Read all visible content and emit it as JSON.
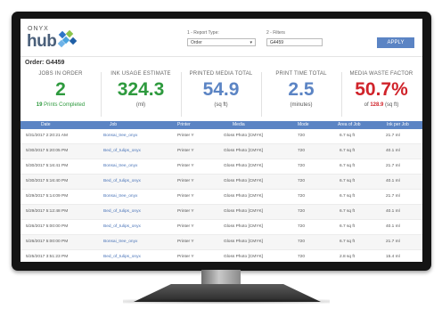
{
  "header": {
    "logo_top": "ONYX",
    "logo_main": "hub",
    "report_type_label": "1 - Report Type:",
    "report_type_value": "Order",
    "filters_label": "2 - Filters",
    "filters_value": "G4459",
    "apply_label": "APPLY"
  },
  "order": {
    "label": "Order:",
    "id": "G4459"
  },
  "kpis": [
    {
      "title": "JOBS IN ORDER",
      "value": "2",
      "sub_strong": "19",
      "sub_text": "Prints Completed",
      "color": "#2e9a3e"
    },
    {
      "title": "INK USAGE ESTIMATE",
      "value": "324.3",
      "sub_text": "(ml)",
      "color": "#2e9a3e"
    },
    {
      "title": "PRINTED MEDIA TOTAL",
      "value": "54.9",
      "sub_text": "(sq ft)",
      "color": "#5b84c4"
    },
    {
      "title": "PRINT TIME TOTAL",
      "value": "2.5",
      "sub_text": "(minutes)",
      "color": "#5b84c4"
    },
    {
      "title": "MEDIA WASTE FACTOR",
      "value": "50.7%",
      "sub_pre": "of",
      "sub_strong": "128.9",
      "sub_text": "(sq ft)",
      "color": "#d0232a"
    }
  ],
  "table": {
    "columns": [
      "Date",
      "Job",
      "Printer",
      "Media",
      "Mode",
      "Area of Job",
      "Ink per Job"
    ],
    "rows": [
      [
        "5/31/2017 2:20:21 AM",
        "Bonsai_tree_onyx",
        "Printer Y",
        "Gloss Photo [CMYK]",
        "720",
        "6.7 sq ft",
        "21.7 ml"
      ],
      [
        "5/30/2017 5:20:05 PM",
        "Bed_of_tulips_onyx",
        "Printer Y",
        "Gloss Photo [CMYK]",
        "720",
        "6.7 sq ft",
        "40.1 ml"
      ],
      [
        "5/30/2017 5:16:41 PM",
        "Bonsai_tree_onyx",
        "Printer Y",
        "Gloss Photo [CMYK]",
        "720",
        "6.7 sq ft",
        "21.7 ml"
      ],
      [
        "5/30/2017 5:16:40 PM",
        "Bed_of_tulips_onyx",
        "Printer Y",
        "Gloss Photo [CMYK]",
        "720",
        "6.7 sq ft",
        "40.1 ml"
      ],
      [
        "5/29/2017 5:14:09 PM",
        "Bonsai_tree_onyx",
        "Printer Y",
        "Gloss Photo [CMYK]",
        "720",
        "6.7 sq ft",
        "21.7 ml"
      ],
      [
        "5/29/2017 5:12:48 PM",
        "Bed_of_tulips_onyx",
        "Printer Y",
        "Gloss Photo [CMYK]",
        "720",
        "6.7 sq ft",
        "40.1 ml"
      ],
      [
        "5/26/2017 5:00:00 PM",
        "Bed_of_tulips_onyx",
        "Printer Y",
        "Gloss Photo [CMYK]",
        "720",
        "6.7 sq ft",
        "40.1 ml"
      ],
      [
        "5/26/2017 5:00:00 PM",
        "Bonsai_tree_onyx",
        "Printer Y",
        "Gloss Photo [CMYK]",
        "720",
        "6.7 sq ft",
        "21.7 ml"
      ],
      [
        "5/25/2017 3:51:23 PM",
        "Bed_of_tulips_onyx",
        "Printer Y",
        "Gloss Photo [CMYK]",
        "720",
        "2.8 sq ft",
        "15.4 ml"
      ],
      [
        "5/25/2017 3:51:22 PM",
        "Bed_of_tulips_onyx",
        "Printer Y",
        "Gloss Photo [CMYK]",
        "720",
        "2.8 sq ft",
        "15.4 ml"
      ]
    ]
  },
  "colors": {
    "accent": "#5b84c4",
    "green": "#2e9a3e",
    "red": "#d0232a",
    "bezel": "#141414"
  }
}
